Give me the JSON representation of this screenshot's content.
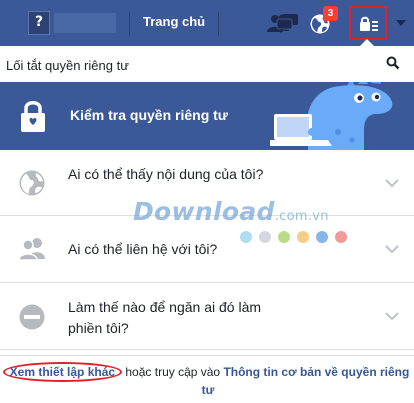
{
  "topbar": {
    "profile_initial": "?",
    "home_label": "Trang chủ",
    "notification_count": "3",
    "colors": {
      "bar": "#3b5998",
      "badge": "#fa3e3e",
      "highlight": "#e0212c"
    },
    "icons": [
      "friends-icon",
      "messages-icon",
      "globe-icon",
      "privacy-shortcuts-icon",
      "caret-down-icon"
    ]
  },
  "panel": {
    "title": "Lối tắt quyền riêng tư",
    "banner_label": "Kiểm tra quyền riêng tư",
    "items": [
      {
        "label": "Ai có thể thấy nội dung của tôi?",
        "icon": "globe-icon"
      },
      {
        "label": "Ai có thể liên hệ với tôi?",
        "icon": "people-icon"
      },
      {
        "label": "Làm thế nào để ngăn ai đó làm phiền tôi?",
        "icon": "block-icon"
      }
    ]
  },
  "watermark": {
    "text": "Download",
    "suffix": ".com.vn"
  },
  "footer": {
    "see_settings": "Xem thiết lập khác",
    "middle": " hoặc truy cập vào ",
    "basics_link": "Thông tin cơ bản về quyền riêng tư"
  }
}
